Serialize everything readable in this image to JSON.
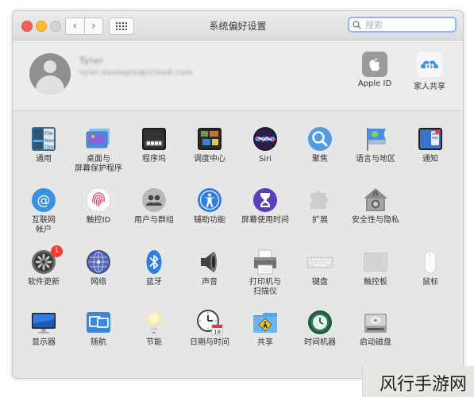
{
  "window": {
    "title": "系统偏好设置"
  },
  "toolbar": {
    "back": "‹",
    "forward": "›"
  },
  "search": {
    "placeholder": "搜索"
  },
  "account": {
    "name": "Tyler",
    "email": "tyler.example@icloud.com",
    "items": [
      {
        "label": "Apple ID",
        "icon": "apple-id-icon"
      },
      {
        "label": "家人共享",
        "icon": "family-sharing-icon"
      }
    ]
  },
  "section1": [
    {
      "label": "通用",
      "icon": "general-icon"
    },
    {
      "label": "桌面与\n屏幕保护程序",
      "icon": "desktop-screensaver-icon"
    },
    {
      "label": "程序坞",
      "icon": "dock-icon"
    },
    {
      "label": "调度中心",
      "icon": "mission-control-icon"
    },
    {
      "label": "Siri",
      "icon": "siri-icon"
    },
    {
      "label": "聚焦",
      "icon": "spotlight-icon"
    },
    {
      "label": "语言与地区",
      "icon": "language-region-icon"
    },
    {
      "label": "通知",
      "icon": "notifications-icon"
    },
    {
      "label": "互联网\n帐户",
      "icon": "internet-accounts-icon"
    },
    {
      "label": "触控ID",
      "icon": "touch-id-icon"
    },
    {
      "label": "用户与群组",
      "icon": "users-groups-icon"
    },
    {
      "label": "辅助功能",
      "icon": "accessibility-icon"
    },
    {
      "label": "屏幕使用时间",
      "icon": "screen-time-icon"
    },
    {
      "label": "扩展",
      "icon": "extensions-icon"
    },
    {
      "label": "安全性与隐私",
      "icon": "security-privacy-icon"
    }
  ],
  "section2": [
    {
      "label": "软件更新",
      "icon": "software-update-icon",
      "badge": "1"
    },
    {
      "label": "网络",
      "icon": "network-icon"
    },
    {
      "label": "蓝牙",
      "icon": "bluetooth-icon"
    },
    {
      "label": "声音",
      "icon": "sound-icon"
    },
    {
      "label": "打印机与\n扫描仪",
      "icon": "printers-scanners-icon"
    },
    {
      "label": "键盘",
      "icon": "keyboard-icon"
    },
    {
      "label": "触控板",
      "icon": "trackpad-icon"
    },
    {
      "label": "鼠标",
      "icon": "mouse-icon"
    },
    {
      "label": "显示器",
      "icon": "displays-icon"
    },
    {
      "label": "随航",
      "icon": "sidecar-icon"
    },
    {
      "label": "节能",
      "icon": "energy-saver-icon"
    },
    {
      "label": "日期与时间",
      "icon": "date-time-icon"
    },
    {
      "label": "共享",
      "icon": "sharing-icon"
    },
    {
      "label": "时间机器",
      "icon": "time-machine-icon"
    },
    {
      "label": "启动磁盘",
      "icon": "startup-disk-icon"
    }
  ],
  "watermark": {
    "text": "风行手游网"
  },
  "colors": {
    "accent": "#3b82f6",
    "badge": "#ff3b30"
  }
}
